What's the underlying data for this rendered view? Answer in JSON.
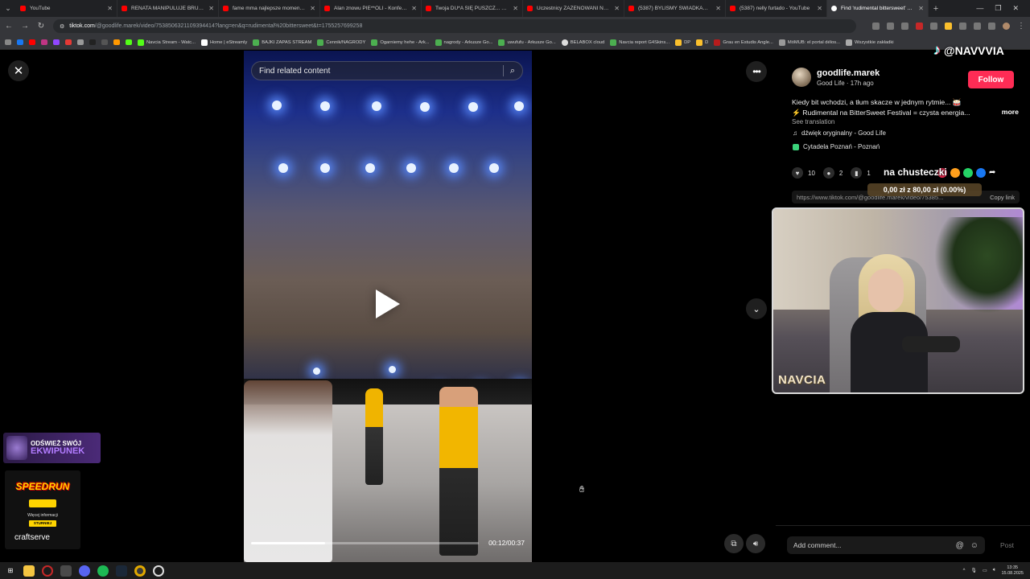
{
  "tabs": [
    {
      "title": "YouTube",
      "active": false
    },
    {
      "title": "RENATA MANIPULUJE BRUSEM? W",
      "active": false
    },
    {
      "title": "fame mma najlepsze momenty - Y",
      "active": false
    },
    {
      "title": "Alan znowu PIE**OLI - Konferencja",
      "active": false
    },
    {
      "title": "Twoja DU*A SIĘ PUSZCZ... Konfer",
      "active": false
    },
    {
      "title": "Uczestnicy ZAŻENOWANI Najman",
      "active": false
    },
    {
      "title": "(5387) BYLIŚMY ŚWIADKAMI TRA",
      "active": false
    },
    {
      "title": "(5387) nelly furtado - YouTube",
      "active": false
    },
    {
      "title": "Find 'rudimental bittersweet' on Ti",
      "active": true
    }
  ],
  "address": {
    "host": "tiktok.com",
    "path": "/@goodlife.marek/video/7538506321109394414?lang=en&q=rudimental%20bittersweet&t=1755257699258"
  },
  "bookmarks": [
    "Navcia Stream - Watc...",
    "Home | eStreamly",
    "BAJKI ZAPAS STREAM",
    "Cennik/NAGRODY",
    "Ogarniemy hehe - Ark...",
    "nagrody - Arkusze Go...",
    "uwufufu - Arkusze Go...",
    "BELABOX cloud",
    "Navcia report G4Skins...",
    "DP",
    "D",
    "Grau en Estudis Angle...",
    "MóMUB: el portal délos...",
    "Wszystkie zakładki"
  ],
  "video": {
    "search_placeholder": "Find related content",
    "time": "00:12/00:37",
    "progress": 0.324
  },
  "post": {
    "author": "goodlife.marek",
    "subtitle": "Good Life · 17h ago",
    "follow": "Follow",
    "desc_line1": "Kiedy bit wchodzi, a tłum skacze w jednym rytmie... 🥁",
    "desc_line2": "⚡ Rudimental na BitterSweet Festival = czysta energia...",
    "more": "more",
    "see_translation": "See translation",
    "sound": "dźwięk oryginalny - Good Life",
    "location": "Cytadela Poznań - Poznań",
    "likes": "10",
    "comments": "2",
    "saves": "1",
    "link": "https://www.tiktok.com/@goodlife.marek/video/75385...",
    "copy_link": "Copy link",
    "comment_placeholder": "Add comment...",
    "post_label": "Post"
  },
  "overlay": {
    "brand": "@NAVVVIA",
    "donation_text": "na chusteczki",
    "donation_amount": "0,00 zł z 80,00 zł (0.00%)",
    "webcam_name": "NAVCIA",
    "promo1_line1": "ODŚWIEŻ SWÓJ",
    "promo1_line2": "EKWIPUNEK",
    "promo2_logo": "SPEEDRUN",
    "promo2_info": "Więcej informacji",
    "promo2_tag": "STURNIEJ",
    "promo2_craft": "craftserve"
  },
  "taskbar": {
    "time": "13:35",
    "date": "15.08.2025"
  },
  "colors": {
    "accent": "#fe2c55",
    "browser_bg": "#202124"
  }
}
